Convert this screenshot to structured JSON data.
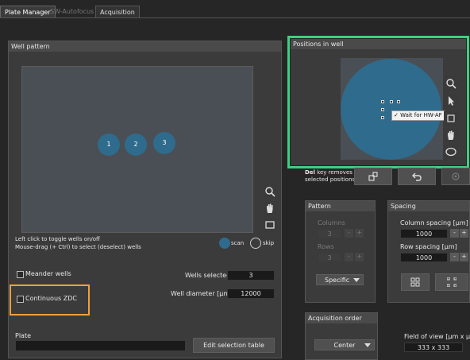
{
  "tabs": [
    {
      "label": "Plate Manager",
      "active": true
    },
    {
      "label": "SW-Autofocus",
      "active": false
    },
    {
      "label": "Acquisition",
      "active": false
    }
  ],
  "well_pattern": {
    "title": "Well pattern",
    "wells": [
      "1",
      "2",
      "3"
    ],
    "help_line1": "Left click to toggle wells on/off",
    "help_line2": "Mouse-drag (+ Ctrl)  to select (deselect) wells",
    "legend_scan": "scan",
    "legend_skip": "skip",
    "meander_label": "Meander wells",
    "continuous_zdc_label": "Continuous ZDC",
    "wells_selected_label": "Wells selected",
    "wells_selected_value": "3",
    "well_diameter_label": "Well diameter [µm]",
    "well_diameter_value": "12000",
    "plate_label": "Plate",
    "edit_selection_label": "Edit selection table"
  },
  "positions_in_well": {
    "title": "Positions in well",
    "context_item": "✓ Wait for HW-AF",
    "del_key_text": "Del",
    "del_rest_line1": " key removes",
    "del_line2": "selected positions"
  },
  "pattern": {
    "title": "Pattern",
    "columns_label": "Columns",
    "columns_value": "3",
    "rows_label": "Rows",
    "rows_value": "3",
    "mode_value": "Specific"
  },
  "spacing": {
    "title": "Spacing",
    "column_spacing_label": "Column spacing [µm]",
    "column_spacing_value": "1000",
    "row_spacing_label": "Row spacing [µm]",
    "row_spacing_value": "1000"
  },
  "acquisition_order": {
    "title": "Acquisition order",
    "value": "Center"
  },
  "field_of_view": {
    "label": "Field of view [µm x µm",
    "value": "333 x 333"
  },
  "colors": {
    "well_blue": "#2f6b8c",
    "highlight_green": "#3fcf7f",
    "highlight_orange": "#f2a13a"
  }
}
